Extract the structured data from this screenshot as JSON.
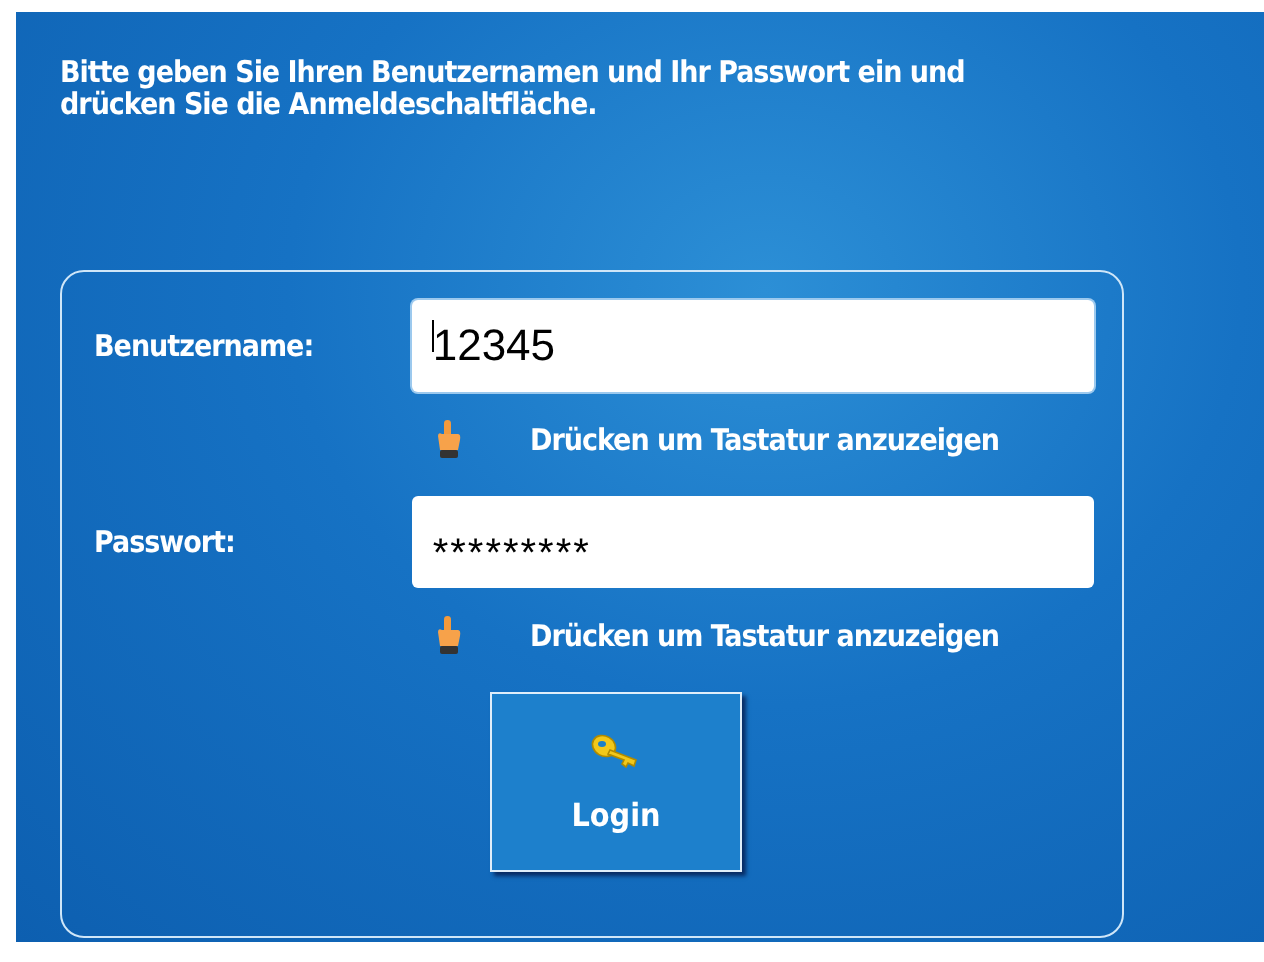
{
  "instruction": "Bitte geben Sie Ihren Benutzernamen und Ihr Passwort ein und drücken Sie die Anmeldeschaltfläche.",
  "fields": [
    {
      "label": "Benutzername:",
      "value": "12345",
      "focused": true,
      "hint": "Drücken um Tastatur anzuzeigen"
    },
    {
      "label": "Passwort:",
      "value": "*********",
      "focused": false,
      "hint": "Drücken um Tastatur anzuzeigen"
    }
  ],
  "login_button": "Login"
}
